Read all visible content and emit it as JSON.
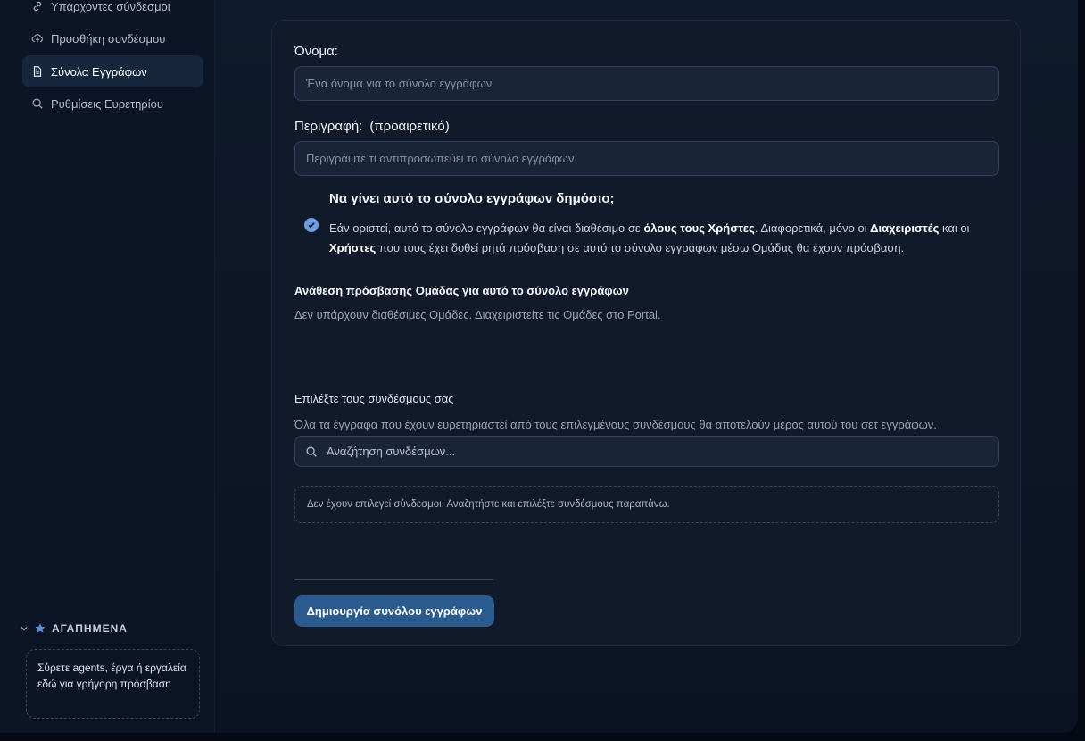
{
  "sidebar": {
    "items": [
      {
        "label": "Υπάρχοντες σύνδεσμοι",
        "icon": "link-icon"
      },
      {
        "label": "Προσθήκη συνδέσμου",
        "icon": "cloud-upload-icon"
      },
      {
        "label": "Σύνολα Εγγράφων",
        "icon": "document-icon"
      },
      {
        "label": "Ρυθμίσεις Ευρετηρίου",
        "icon": "search-icon"
      }
    ],
    "favorites": {
      "title": "ΑΓΑΠΗΜΕΝΑ",
      "drop_hint": "Σύρετε agents, έργα ή εργαλεία εδώ για γρήγορη πρόσβαση"
    }
  },
  "form": {
    "name_label": "Όνομα:",
    "name_placeholder": "Ένα όνομα για το σύνολο εγγράφων",
    "description_label": "Περιγραφή:",
    "description_optional": "(προαιρετικό)",
    "description_placeholder": "Περιγράψτε τι αντιπροσωπεύει το σύνολο εγγράφων",
    "public": {
      "checked": true,
      "title": "Να γίνει αυτό το σύνολο εγγράφων δημόσιο;",
      "desc_1": "Εάν οριστεί, αυτό το σύνολο εγγράφων θα είναι διαθέσιμο σε ",
      "desc_all_users": "όλους τους Χρήστες",
      "desc_2": ". Διαφορετικά, μόνο οι ",
      "desc_admins": "Διαχειριστές",
      "desc_3": " και οι ",
      "desc_users": "Χρήστες",
      "desc_4": " που τους έχει δοθεί ρητά πρόσβαση σε αυτό το σύνολο εγγράφων μέσω Ομάδας θα έχουν πρόσβαση."
    },
    "group_access_title": "Ανάθεση πρόσβασης Ομάδας για αυτό το σύνολο εγγράφων",
    "group_access_empty": "Δεν υπάρχουν διαθέσιμες Ομάδες. Διαχειριστείτε τις Ομάδες στο Portal.",
    "connectors_title": "Επιλέξτε τους συνδέσμους σας",
    "connectors_desc": "Όλα τα έγγραφα που έχουν ευρετηριαστεί από τους επιλεγμένους συνδέσμους θα αποτελούν μέρος αυτού του σετ εγγράφων.",
    "connectors_search_placeholder": "Αναζήτηση συνδέσμων...",
    "connectors_empty": "Δεν έχουν επιλεγεί σύνδεσμοι. Αναζητήστε και επιλέξτε συνδέσμους παραπάνω.",
    "submit_label": "Δημιουργία συνόλου εγγράφων"
  },
  "colors": {
    "accent": "#2a5a8e",
    "check": "#6f9ee0",
    "favorites_star": "#5b8fd6"
  }
}
